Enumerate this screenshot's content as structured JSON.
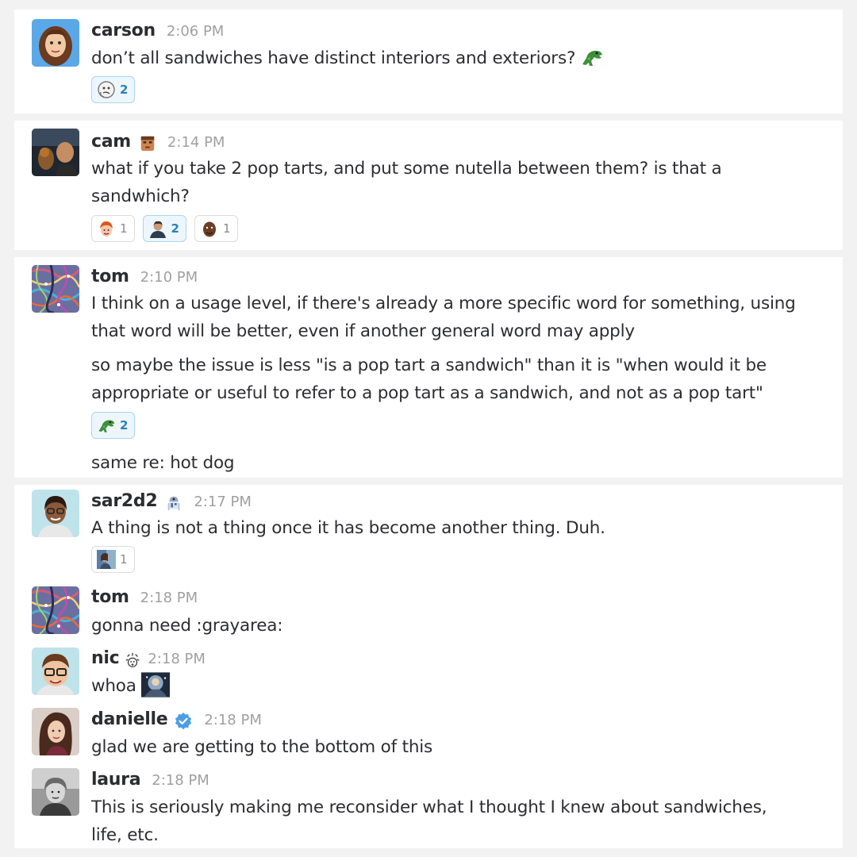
{
  "messages": [
    {
      "user": "carson",
      "time": "2:06 PM",
      "lines": [
        "don’t all sandwiches have distinct interiors and exteriors?"
      ],
      "inline_emoji": "dinosaur-icon",
      "reactions": [
        {
          "emoji": "thinking-face-icon",
          "count": "2",
          "active": true
        }
      ]
    },
    {
      "user": "cam",
      "status_emoji": "doomguy-face-icon",
      "time": "2:14 PM",
      "lines": [
        "what if you take 2 pop tarts, and put some nutella between them? is that a",
        "sandwhich?"
      ],
      "reactions": [
        {
          "emoji": "red-hair-face-icon",
          "count": "1",
          "active": false
        },
        {
          "emoji": "person-face-icon",
          "count": "2",
          "active": true
        },
        {
          "emoji": "dark-face-icon",
          "count": "1",
          "active": false
        }
      ]
    },
    {
      "user": "tom",
      "time": "2:10 PM",
      "lines": [
        "I think on a usage level, if there's already a more specific word for something, using",
        "that word will be better, even if another general word may apply"
      ],
      "followup_lines": [
        "so maybe the issue is less \"is a pop tart a sandwich\" than it is \"when would it be",
        "appropriate or useful to refer to a pop tart as a sandwich, and not as a pop tart\""
      ],
      "reactions": [
        {
          "emoji": "dinosaur-icon",
          "count": "2",
          "active": true
        }
      ],
      "last_line": "same re: hot dog"
    },
    {
      "user": "sar2d2",
      "status_emoji": "r2d2-icon",
      "time": "2:17 PM",
      "lines": [
        "A thing is not a thing once it has become another thing. Duh."
      ],
      "reactions": [
        {
          "emoji": "photo-face-icon",
          "count": "1",
          "active": false
        }
      ]
    },
    {
      "user": "tom",
      "time": "2:18 PM",
      "lines": [
        "gonna need :grayarea:"
      ]
    },
    {
      "user": "nic",
      "status_emoji": "mind-blown-icon",
      "time": "2:18 PM",
      "lines": [
        "whoa"
      ],
      "inline_emoji": "whoa-image-icon"
    },
    {
      "user": "danielle",
      "status_emoji": "verified-icon",
      "time": "2:18 PM",
      "lines": [
        "glad we are getting to the bottom of this"
      ]
    },
    {
      "user": "laura",
      "time": "2:18 PM",
      "lines": [
        "This is seriously making me reconsider what I thought I knew about sandwiches,",
        "life, etc."
      ]
    }
  ],
  "colors": {
    "active_reaction_border": "#aed3ef",
    "active_reaction_bg": "#edf6fd",
    "active_reaction_count": "#2a80b9",
    "timestamp": "#a0a0a2",
    "verified": "#4a9fe4"
  }
}
